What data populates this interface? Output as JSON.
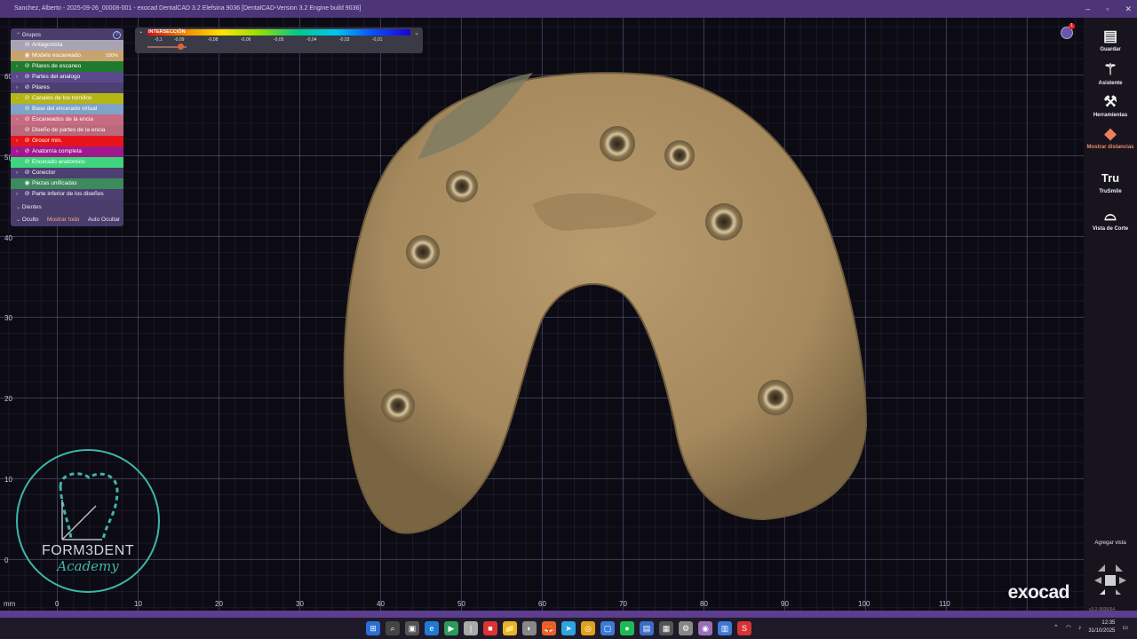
{
  "window": {
    "title": "Sanchez, Alberto - 2025-09-26_00008-001 - exocad DentalCAD 3.2 Elefsina 9036 [DentalCAD-Version 3.2 Engine build 9036]",
    "controls": [
      "–",
      "▫",
      "✕"
    ]
  },
  "axes": {
    "unit": "mm",
    "x_ticks": [
      "0",
      "10",
      "20",
      "30",
      "40",
      "50",
      "60",
      "70",
      "80",
      "90",
      "100",
      "110"
    ],
    "y_ticks": [
      "40",
      "30",
      "20",
      "10",
      "0"
    ],
    "y_partial": [
      "60",
      "5("
    ]
  },
  "groups_panel": {
    "title": "Grupos",
    "help": "?",
    "items": [
      {
        "label": "Antagonista",
        "color": "#a9a4b4",
        "arrow": "",
        "eye": "⊘"
      },
      {
        "label": "Modelo escaneado",
        "color": "#c9a36d",
        "arrow": "",
        "eye": "◉",
        "badge": "100%"
      },
      {
        "label": "Pilares de escaneo",
        "color": "#1f7a2e",
        "arrow": "›",
        "eye": "⊘"
      },
      {
        "label": "Partes del analogo",
        "color": "#5a4a8c",
        "arrow": "›",
        "eye": "⊘"
      },
      {
        "label": "Pilares",
        "color": "#4c3f71",
        "arrow": "›",
        "eye": "⊘"
      },
      {
        "label": "Canales de los tornillos",
        "color": "#b5b517",
        "arrow": "›",
        "eye": "⊘"
      },
      {
        "label": "Base del encerado virtual",
        "color": "#7fa2c7",
        "arrow": "",
        "eye": "⊘"
      },
      {
        "label": "Escaneados de la encia",
        "color": "#c76a82",
        "arrow": "›",
        "eye": "⊘"
      },
      {
        "label": "Diseño de partes de la encia",
        "color": "#b9697b",
        "arrow": "",
        "eye": "⊘"
      },
      {
        "label": "Grosor min.",
        "color": "#e8141b",
        "arrow": "›",
        "eye": "⊘"
      },
      {
        "label": "Anatomía completa",
        "color": "#a1178e",
        "arrow": "›",
        "eye": "⊘"
      },
      {
        "label": "Encerado anatomico",
        "color": "#3fd57d",
        "arrow": "",
        "eye": "⊘"
      },
      {
        "label": "Conector",
        "color": "#4c3f71",
        "arrow": "›",
        "eye": "⊘"
      },
      {
        "label": "Piezas unificadas",
        "color": "#3d8a5c",
        "arrow": "",
        "eye": "◉"
      },
      {
        "label": "Parte inferior de los diseños",
        "color": "#4c3f71",
        "arrow": "›",
        "eye": "⊘"
      }
    ],
    "teeth_section": "Dientes",
    "hidden_label": "Oculto",
    "show_all": "Mostrar todo",
    "auto_hide": "Auto Ocultar"
  },
  "distance_bar": {
    "title": "INTERSECCIÓN",
    "ticks": [
      "-0,1",
      "-0,09",
      "-0,08",
      "-0,06",
      "-0,05",
      "-0,04",
      "-0,03",
      "-0,01"
    ],
    "slider_fraction": 0.85
  },
  "notification_count": "1",
  "logo": {
    "line1": "FORM3DENT",
    "line2": "Academy"
  },
  "brand": "exocad",
  "sidebar": {
    "tools": [
      {
        "label": "Guardar",
        "icon": "💾"
      },
      {
        "label": "Asistente",
        "icon": "✨"
      },
      {
        "label": "Herramientas",
        "icon": "⚒"
      },
      {
        "label": "Mostrar distancias",
        "icon": "◆",
        "active": true
      },
      {
        "label": "TruSmile",
        "icon": "Tru"
      },
      {
        "label": "Vista de Corte",
        "icon": "◠"
      }
    ],
    "add_view": "Agregar vista",
    "version": "v3.2-9036/64"
  },
  "taskbar": {
    "icons": [
      "⊞",
      "⌕",
      "▣",
      "e",
      "▶",
      "|",
      "■",
      "📁",
      "◐",
      "🦊",
      "➤",
      "◎",
      "▢",
      "●",
      "▤",
      "▦",
      "⚙",
      "◉",
      "▥",
      "S"
    ],
    "time": "12:35",
    "date": "31/10/2025"
  }
}
